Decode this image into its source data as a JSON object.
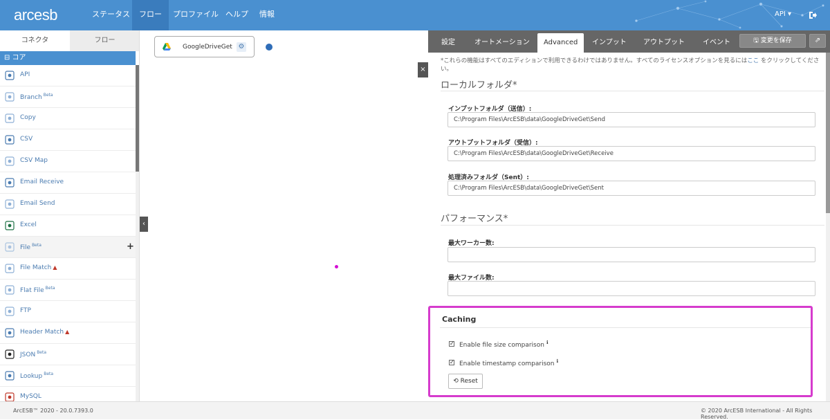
{
  "app": {
    "logo": "arcesb",
    "nav": [
      "ステータス",
      "フロー",
      "プロファイル",
      "ヘルプ",
      "情報"
    ],
    "active_nav": "フロー",
    "api_menu": "API ▾"
  },
  "sidebar": {
    "tabs": [
      "コネクタ",
      "フロー"
    ],
    "section": "⊟ コア",
    "items": [
      {
        "label": "API",
        "beta": "",
        "warn": "",
        "icon": "api-icon"
      },
      {
        "label": "Branch",
        "beta": "Beta",
        "warn": "",
        "icon": "branch-icon"
      },
      {
        "label": "Copy",
        "beta": "",
        "warn": "",
        "icon": "copy-icon"
      },
      {
        "label": "CSV",
        "beta": "",
        "warn": "",
        "icon": "csv-icon"
      },
      {
        "label": "CSV Map",
        "beta": "",
        "warn": "",
        "icon": "csv-map-icon"
      },
      {
        "label": "Email Receive",
        "beta": "",
        "warn": "",
        "icon": "email-receive-icon"
      },
      {
        "label": "Email Send",
        "beta": "",
        "warn": "",
        "icon": "email-send-icon"
      },
      {
        "label": "Excel",
        "beta": "",
        "warn": "",
        "icon": "excel-icon"
      },
      {
        "label": "File",
        "beta": "Beta",
        "warn": "",
        "icon": "file-icon"
      },
      {
        "label": "File Match",
        "beta": "",
        "warn": "▲",
        "icon": "file-match-icon"
      },
      {
        "label": "Flat File",
        "beta": "Beta",
        "warn": "",
        "icon": "flat-file-icon"
      },
      {
        "label": "FTP",
        "beta": "",
        "warn": "",
        "icon": "ftp-icon"
      },
      {
        "label": "Header Match",
        "beta": "",
        "warn": "▲",
        "icon": "header-match-icon"
      },
      {
        "label": "JSON",
        "beta": "Beta",
        "warn": "",
        "icon": "json-icon"
      },
      {
        "label": "Lookup",
        "beta": "Beta",
        "warn": "",
        "icon": "lookup-icon"
      },
      {
        "label": "MySQL",
        "beta": "",
        "warn": "",
        "icon": "mysql-icon"
      }
    ]
  },
  "canvas": {
    "node_label": "GoogleDriveGet",
    "collapse": "‹",
    "close": "×"
  },
  "panel": {
    "tabs": [
      "設定",
      "オートメーション",
      "Advanced",
      "インプット",
      "アウトプット",
      "イベント"
    ],
    "active_tab": "Advanced",
    "save_label": "🖫 変更を保存",
    "ext_label": "⇗",
    "note_text": "*これらの機能はすべてのエディションで利用できるわけではありません。すべてのライセンスオプションを見るには",
    "note_link": "ここ",
    "note_text2": " をクリックしてください。",
    "local_title": "ローカルフォルダ*",
    "input_folder_label": "インプットフォルダ（送信）:",
    "input_folder_value": "C:\\Program Files\\ArcESB\\data\\GoogleDriveGet\\Send",
    "output_folder_label": "アウトプットフォルダ（受信）:",
    "output_folder_value": "C:\\Program Files\\ArcESB\\data\\GoogleDriveGet\\Receive",
    "sent_folder_label": "処理済みフォルダ（Sent）:",
    "sent_folder_value": "C:\\Program Files\\ArcESB\\data\\GoogleDriveGet\\Sent",
    "perf_title": "パフォーマンス*",
    "max_workers_label": "最大ワーカー数:",
    "max_workers_value": "",
    "max_files_label": "最大ファイル数:",
    "max_files_value": "",
    "caching_title": "Caching",
    "file_size_label": "Enable file size comparison",
    "file_size_checked": true,
    "timestamp_label": "Enable timestamp comparison",
    "timestamp_checked": true,
    "reset_label": "⟲ Reset"
  },
  "footer": {
    "left": "ArcESB™ 2020 - 20.0.7393.0",
    "right": "© 2020 ArcESB International - All Rights Reserved."
  },
  "colors": {
    "brand": "#4a90d0",
    "highlight": "#d63bcd",
    "port": "#2f6db8"
  }
}
